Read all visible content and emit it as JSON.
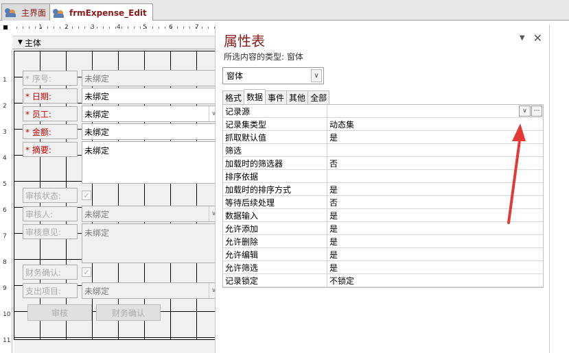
{
  "tabs": [
    {
      "label": "主界面",
      "active": false
    },
    {
      "label": "frmExpense_Edit",
      "active": true
    }
  ],
  "ruler": {
    "numbers": [
      "1",
      "2",
      "3",
      "4",
      "5",
      "6",
      "7"
    ],
    "left_numbers": [
      "1",
      "2",
      "3",
      "4",
      "5",
      "6",
      "7",
      "8",
      "9",
      "10",
      "11"
    ]
  },
  "section": {
    "label": "主体"
  },
  "form": {
    "seq_label": "* 序号:",
    "seq_value": "未绑定",
    "date_label": "* 日期:",
    "date_value": "未绑定",
    "emp_label": "* 员工:",
    "emp_value": "未绑定",
    "amount_label": "* 金额:",
    "amount_value": "未绑定",
    "summary_label": "* 摘要:",
    "summary_value": "未绑定",
    "audit_status_label": "审核状态:",
    "auditor_label": "审核人:",
    "auditor_value": "未绑定",
    "audit_opinion_label": "审核意见:",
    "audit_opinion_value": "未绑定",
    "finance_confirm_label": "财务确认:",
    "expense_item_label": "支出项目:",
    "expense_item_value": "未绑定",
    "audit_button": "审核",
    "finance_button": "财务确认"
  },
  "property_sheet": {
    "title": "属性表",
    "selection_type": "所选内容的类型:  窗体",
    "selected_object": "窗体",
    "tabs": [
      {
        "label": "格式",
        "active": false
      },
      {
        "label": "数据",
        "active": true
      },
      {
        "label": "事件",
        "active": false
      },
      {
        "label": "其他",
        "active": false
      },
      {
        "label": "全部",
        "active": false
      }
    ],
    "rows": [
      {
        "name": "记录源",
        "value": ""
      },
      {
        "name": "记录集类型",
        "value": "动态集"
      },
      {
        "name": "抓取默认值",
        "value": "是"
      },
      {
        "name": "筛选",
        "value": ""
      },
      {
        "name": "加载时的筛选器",
        "value": "否"
      },
      {
        "name": "排序依据",
        "value": ""
      },
      {
        "name": "加载时的排序方式",
        "value": "是"
      },
      {
        "name": "等待后续处理",
        "value": "否"
      },
      {
        "name": "数据输入",
        "value": "是"
      },
      {
        "name": "允许添加",
        "value": "是"
      },
      {
        "name": "允许删除",
        "value": "是"
      },
      {
        "name": "允许编辑",
        "value": "是"
      },
      {
        "name": "允许筛选",
        "value": "是"
      },
      {
        "name": "记录锁定",
        "value": "不锁定"
      }
    ]
  },
  "colors": {
    "accent": "#8b1a1a",
    "required": "#c00000",
    "arrow": "#e53935"
  }
}
